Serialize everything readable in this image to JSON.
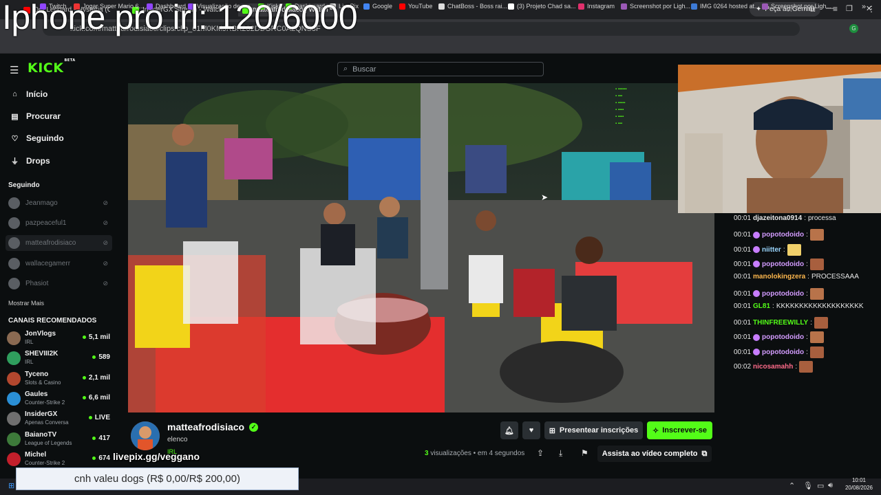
{
  "browser": {
    "tabs": [
      {
        "label": "Def Leppard - Hysteria (Officia",
        "color": "#ff0000"
      },
      {
        "label": "InsiderGX Stream - Watch",
        "color": "#53fc18"
      },
      {
        "label": "matteafrodisiaco | Watch",
        "color": "#53fc18"
      }
    ],
    "gemini_button": "Peça ao Gemini",
    "url": "kick.com/matteafrodisiaco/clips/clip_01M0KMJRBK232DBGRC0A2QNS3F",
    "bookmarks": [
      "Twitch",
      "Jogar Super Mario 6...",
      "Dashboard",
      "Visualização de mo...",
      "Kick",
      "Dashboard",
      "LivePix",
      "Google",
      "YouTube",
      "ChatBoss - Boss rai...",
      "(3) Projeto Chad sa...",
      "Instagram",
      "Screenshot por Ligh...",
      "IMG 0264 hosted at...",
      "Screenshot por Ligh..."
    ]
  },
  "kick": {
    "logo": "KICK",
    "logo_badge": "BETA",
    "search_placeholder": "Buscar",
    "nav": [
      "Início",
      "Procurar",
      "Seguindo",
      "Drops"
    ],
    "following_title": "Seguindo",
    "following": [
      "Jeanmago",
      "pazpeaceful1",
      "matteafrodisiaco",
      "wallacegamerr",
      "Phasiot"
    ],
    "show_more": "Mostrar Mais",
    "recommended_title": "CANAIS RECOMENDADOS",
    "recommended": [
      {
        "name": "JonVlogs",
        "category": "IRL",
        "viewers": "5,1 mil",
        "color": "#8a6a52"
      },
      {
        "name": "SHEVIII2K",
        "category": "IRL",
        "viewers": "589",
        "color": "#2f9e5d"
      },
      {
        "name": "Tyceno",
        "category": "Slots & Casino",
        "viewers": "2,1 mil",
        "color": "#b3472e"
      },
      {
        "name": "Gaules",
        "category": "Counter-Strike 2",
        "viewers": "6,6 mil",
        "color": "#2a8fd6"
      },
      {
        "name": "InsiderGX",
        "category": "Apenas Conversa",
        "viewers": "LIVE",
        "color": "#6f6f6f"
      },
      {
        "name": "BaianoTV",
        "category": "League of Legends",
        "viewers": "417",
        "color": "#3d7a3a"
      },
      {
        "name": "Michel",
        "category": "Counter-Strike 2",
        "viewers": "674",
        "color": "#c21f2b"
      }
    ]
  },
  "channel": {
    "name": "matteafrodisiaco",
    "subtitle": "elenco",
    "category": "IRL",
    "gift_button": "Presentear inscrições",
    "subscribe_button": "Inscrever-se",
    "views_count": "3",
    "views_label": "visualizações",
    "time_ago": "• em 4 segundos",
    "watch_full": "Assista ao vídeo completo"
  },
  "chat": [
    {
      "time": "00:01",
      "user": "djazeitona0914",
      "text": "processa",
      "color": "#e8e8e8",
      "emote": false
    },
    {
      "time": "00:01",
      "user": "popotodoido",
      "text": "",
      "color": "#d39cff",
      "emote": true,
      "badge": true
    },
    {
      "time": "00:01",
      "user": "niitter",
      "text": "",
      "color": "#9ad6ff",
      "emote": true,
      "badge": true
    },
    {
      "time": "00:01",
      "user": "popotodoido",
      "text": "",
      "color": "#d39cff",
      "emote": true,
      "badge": true
    },
    {
      "time": "00:01",
      "user": "manolokingzera",
      "text": "PROCESSAAA",
      "color": "#ffb84d",
      "emote": false
    },
    {
      "time": "00:01",
      "user": "popotodoido",
      "text": "",
      "color": "#d39cff",
      "emote": true,
      "badge": true
    },
    {
      "time": "00:01",
      "user": "GL81",
      "text": "KKKKKKKKKKKKKKKKKKK",
      "color": "#53fc18",
      "emote": false
    },
    {
      "time": "00:01",
      "user": "THINFREEWILLY",
      "text": "",
      "color": "#53fc18",
      "emote": true
    },
    {
      "time": "00:01",
      "user": "popotodoido",
      "text": "",
      "color": "#d39cff",
      "emote": true,
      "badge": true
    },
    {
      "time": "00:01",
      "user": "popotodoido",
      "text": "",
      "color": "#d39cff",
      "emote": true,
      "badge": true
    },
    {
      "time": "00:02",
      "user": "nicosamahh",
      "text": "",
      "color": "#ff6b8a",
      "emote": true
    }
  ],
  "overlay": {
    "title": "Iphone pro irl: 120/6000",
    "livepix": "livepix.gg/veggano",
    "goal": "cnh valeu dogs (R$ 0,00/R$ 200,00)"
  },
  "taskbar": {
    "time": "10:01",
    "date": "20/08/2026"
  }
}
